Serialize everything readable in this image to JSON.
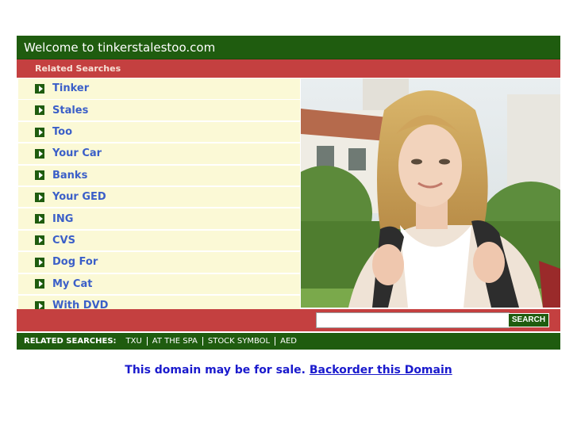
{
  "header": {
    "title": "Welcome to tinkerstalestoo.com"
  },
  "related": {
    "label": "Related Searches"
  },
  "list": [
    "Tinker",
    "Stales",
    "Too",
    "Your Car",
    "Banks",
    "Your GED",
    "ING",
    "CVS",
    "Dog For",
    "My Cat",
    "With DVD"
  ],
  "search": {
    "button_label": "SEARCH",
    "value": ""
  },
  "bottom": {
    "label": "RELATED SEARCHES:",
    "links": [
      "TXU",
      "AT THE SPA",
      "STOCK SYMBOL",
      "AED"
    ]
  },
  "sale": {
    "text": "This domain may be for sale. ",
    "link": "Backorder this Domain"
  },
  "colors": {
    "green": "#1f5c0f",
    "red": "#c44040",
    "cream": "#fbf9d6",
    "link_blue": "#3b5fc8"
  }
}
